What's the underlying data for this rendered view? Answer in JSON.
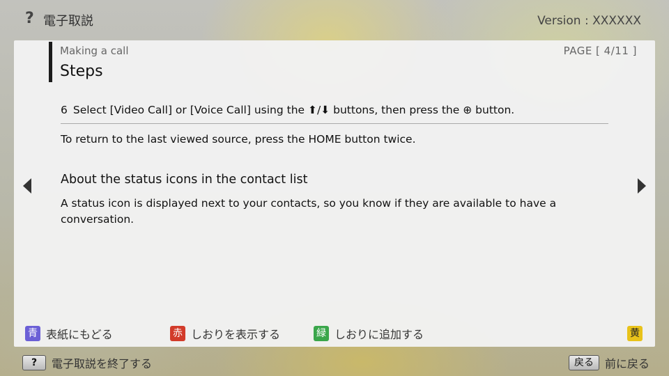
{
  "header": {
    "help_icon": "?",
    "title": "電子取説",
    "version": "Version : XXXXXX"
  },
  "content": {
    "section_label": "Making a call",
    "section_title": "Steps",
    "page_indicator": "PAGE [ 4/11 ]",
    "step_number": "6",
    "step_text_before": "Select [Video Call] or [Voice Call] using the ",
    "step_arrows": "⬆/⬇",
    "step_text_middle": " buttons, then press the ",
    "step_enter_symbol": "⊕",
    "step_text_after": " button.",
    "note": "To return to the last viewed source, press the HOME button twice.",
    "subsection_title": "About the status icons in the contact list",
    "subsection_body": "A status icon is displayed next to your contacts, so you know if they are available to have a conversation."
  },
  "nav": {
    "prev_icon": "arrow-left-icon",
    "next_icon": "arrow-right-icon"
  },
  "legend": {
    "blue": {
      "key": "青",
      "label": "表紙にもどる",
      "color": "#6b5fd6"
    },
    "red": {
      "key": "赤",
      "label": "しおりを表示する",
      "color": "#d23b2a"
    },
    "green": {
      "key": "緑",
      "label": "しおりに追加する",
      "color": "#3aa64a"
    },
    "yellow": {
      "key": "黄",
      "label": "",
      "color": "#e8c21a"
    }
  },
  "footer": {
    "exit_key": "?",
    "exit_label": "電子取説を終了する",
    "back_key": "戻る",
    "back_label": "前に戻る"
  }
}
